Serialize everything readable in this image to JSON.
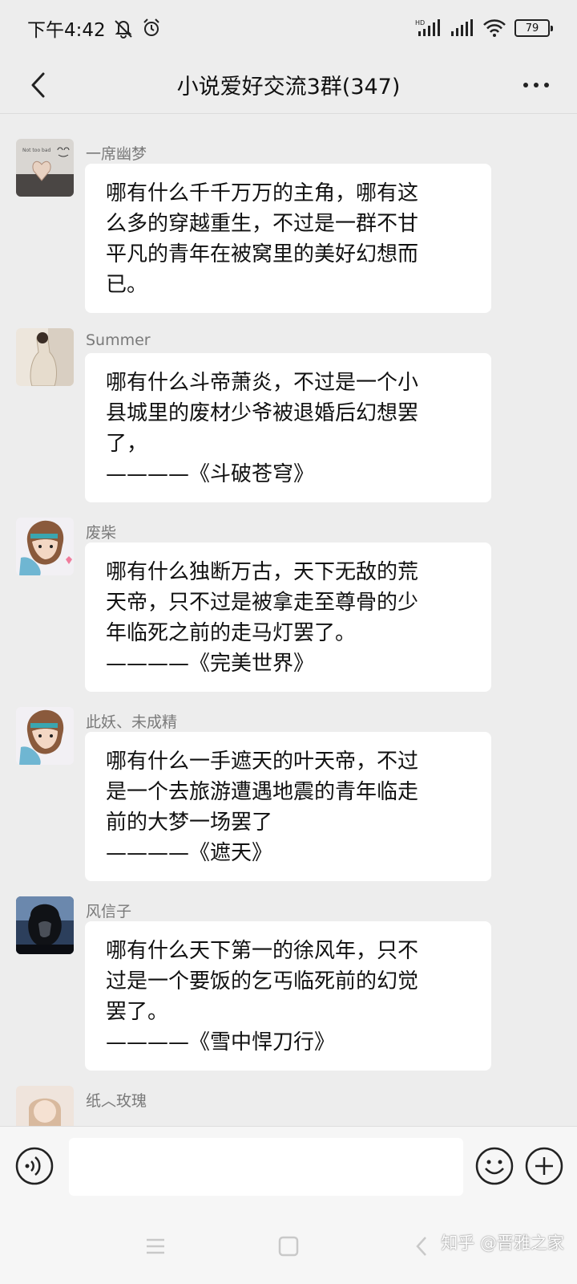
{
  "status_bar": {
    "time": "下午4:42",
    "battery_level": "79",
    "icons": [
      "mute-notification-icon",
      "alarm-icon",
      "hd-signal-icon",
      "signal-icon",
      "wifi-icon",
      "battery-icon"
    ]
  },
  "header": {
    "title": "小说爱好交流3群(347)",
    "back_icon": "chevron-left-icon",
    "more_icon": "more-dots-icon"
  },
  "messages": [
    {
      "nick": "一席幽梦",
      "avatar_style": "hands-heart-photo",
      "lines": [
        "哪有什么千千万万的主角，哪有这",
        "么多的穿越重生，不过是一群不甘",
        "平凡的青年在被窝里的美好幻想而",
        "已。"
      ]
    },
    {
      "nick": "Summer",
      "avatar_style": "beige-fashion-photo",
      "lines": [
        "哪有什么斗帝萧炎，不过是一个小",
        "县城里的废材少爷被退婚后幻想罢",
        "了，",
        "————《斗破苍穹》"
      ]
    },
    {
      "nick": "废柴",
      "avatar_style": "anime-boy-avatar",
      "lines": [
        "哪有什么独断万古，天下无敌的荒",
        "天帝，只不过是被拿走至尊骨的少",
        "年临死之前的走马灯罢了。",
        "————《完美世界》"
      ]
    },
    {
      "nick": "此妖、未成精",
      "avatar_style": "anime-boy-avatar",
      "lines": [
        "哪有什么一手遮天的叶天帝，不过",
        "是一个去旅游遭遇地震的青年临走",
        "前的大梦一场罢了",
        "————《遮天》"
      ]
    },
    {
      "nick": "风信子",
      "avatar_style": "dark-portrait-photo",
      "lines": [
        "哪有什么天下第一的徐风年，只不",
        "过是一个要饭的乞丐临死前的幻觉",
        "罢了。",
        "————《雪中悍刀行》"
      ]
    },
    {
      "nick": "纸︿玫瑰",
      "avatar_style": "light-portrait-photo",
      "lines": []
    }
  ],
  "input_bar": {
    "voice_icon": "voice-icon",
    "input_value": "",
    "emoji_icon": "emoji-icon",
    "plus_icon": "plus-icon"
  },
  "nav_bar": {
    "icons": [
      "menu-icon",
      "home-icon",
      "back-icon"
    ],
    "watermark": "知乎 @晋雅之家"
  },
  "colors": {
    "background": "#ededed",
    "bubble": "#ffffff",
    "nickname": "#7a7a7a",
    "text": "#111111"
  }
}
